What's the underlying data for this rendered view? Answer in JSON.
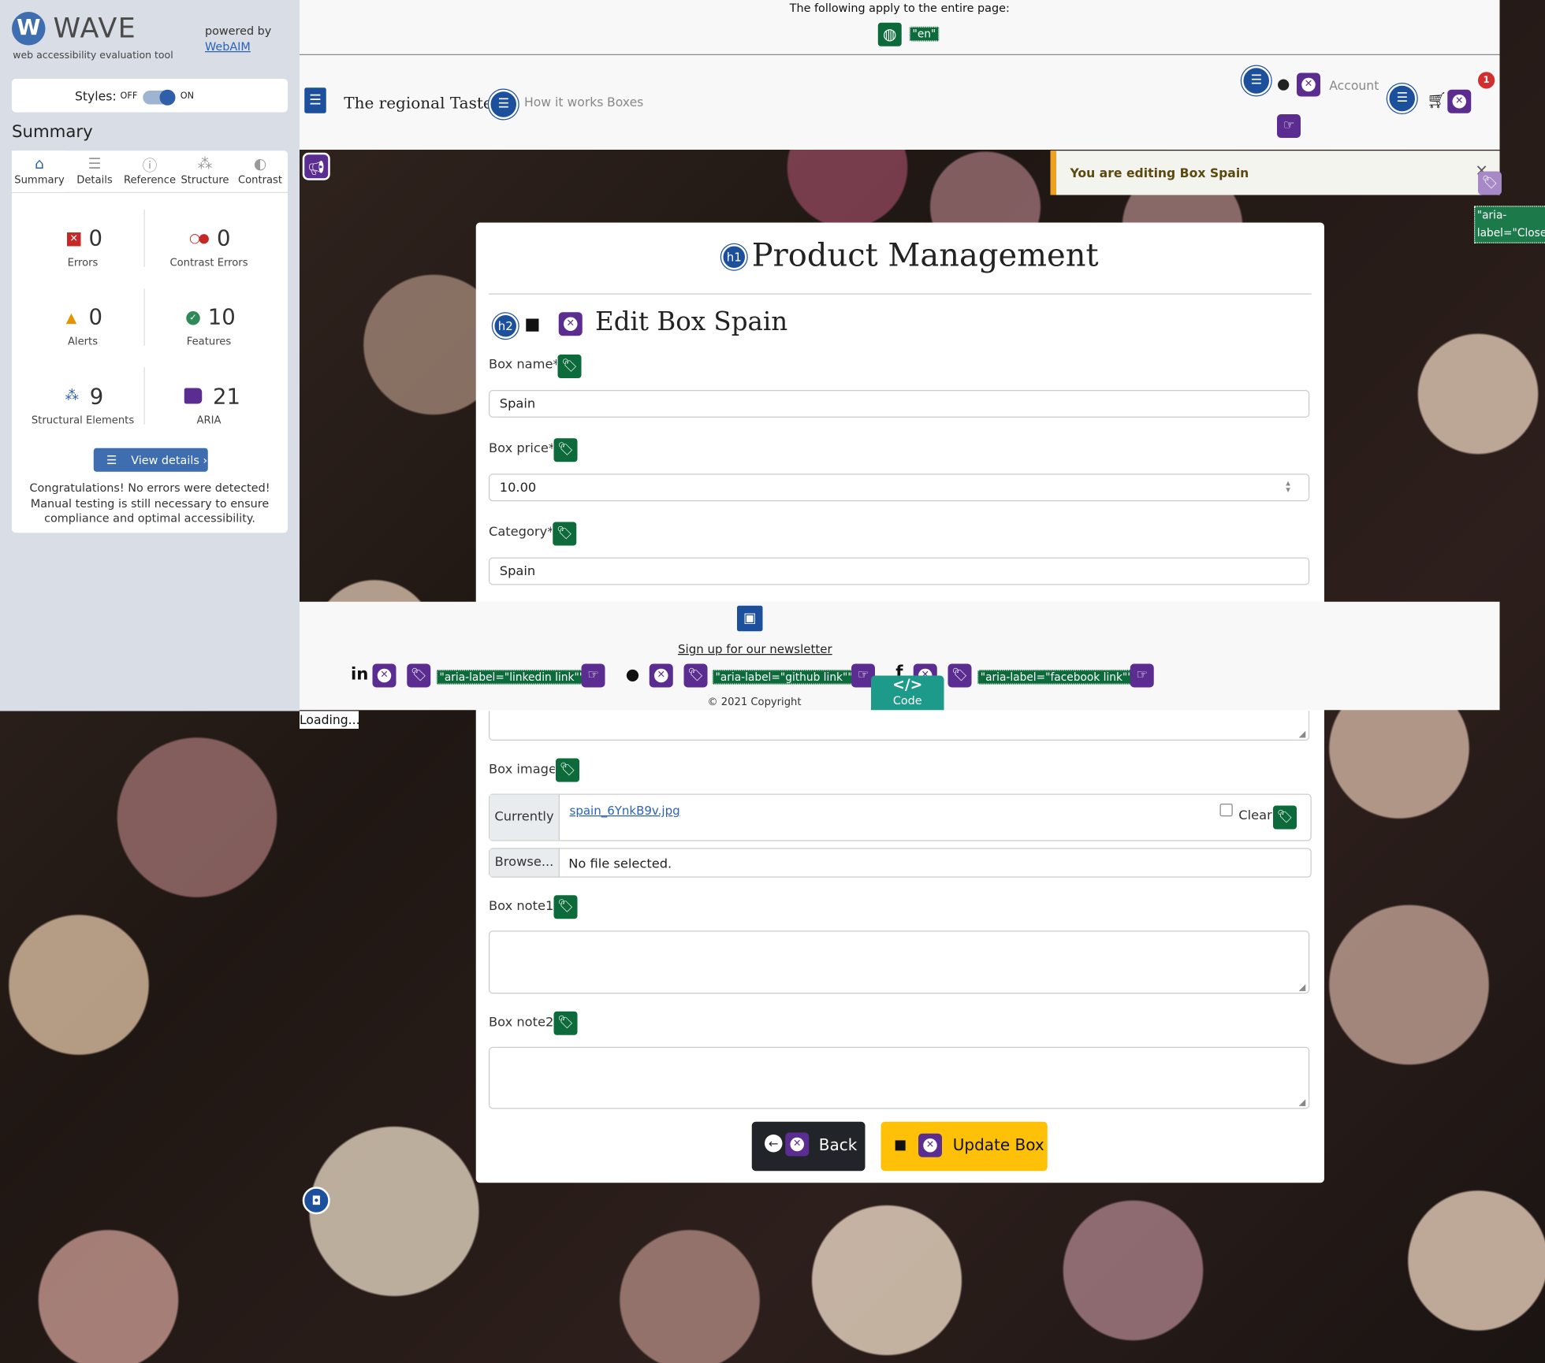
{
  "wave": {
    "logo_letter": "W",
    "title": "WAVE",
    "subtitle": "web accessibility evaluation tool",
    "powered_by": "powered by",
    "powered_link": "WebAIM",
    "styles_label": "Styles:",
    "styles_off": "OFF",
    "styles_on": "ON",
    "summary_heading": "Summary",
    "tabs": [
      {
        "label": "Summary",
        "icon": "home-icon"
      },
      {
        "label": "Details",
        "icon": "list-icon"
      },
      {
        "label": "Reference",
        "icon": "info-icon"
      },
      {
        "label": "Structure",
        "icon": "structure-icon"
      },
      {
        "label": "Contrast",
        "icon": "contrast-icon"
      }
    ],
    "stats": {
      "errors": {
        "count": "0",
        "label": "Errors"
      },
      "contrast": {
        "count": "0",
        "label": "Contrast Errors"
      },
      "alerts": {
        "count": "0",
        "label": "Alerts"
      },
      "features": {
        "count": "10",
        "label": "Features"
      },
      "structural": {
        "count": "9",
        "label": "Structural Elements"
      },
      "aria": {
        "count": "21",
        "label": "ARIA"
      }
    },
    "view_details": "View details ›",
    "congrats": "Congratulations! No errors were detected! Manual testing is still necessary to ensure compliance and optimal accessibility."
  },
  "page_note": {
    "text": "The following apply to the entire page:",
    "lang_badge": "\"en\""
  },
  "nav": {
    "brand": "The regional Taste",
    "links": [
      "How it works",
      "Boxes"
    ],
    "account": "Account",
    "cart_count": "1"
  },
  "toast": {
    "text": "You are editing Box Spain",
    "close": "×",
    "aria_label": "\"aria-label=\"Close\"\""
  },
  "main": {
    "h1_badge": "h1",
    "h1": "Product Management",
    "h2_badge": "h2",
    "h2": "Edit Box Spain",
    "fields": {
      "name_label": "Box name*",
      "name_value": "Spain",
      "price_label": "Box price*",
      "price_value": "10.00",
      "category_label": "Category*",
      "category_value": "Spain",
      "image_label": "Box image",
      "currently": "Currently",
      "current_file": "spain_6YnkB9v.jpg",
      "clear": "Clear",
      "browse": "Browse...",
      "no_file": "No file selected.",
      "note1_label": "Box note1",
      "note2_label": "Box note2"
    },
    "back_button": "Back",
    "update_button": "Update Box"
  },
  "footer": {
    "newsletter": "Sign up for our newsletter",
    "linkedin_label": "\"aria-label=\"linkedin link\"\"",
    "github_label": "\"aria-label=\"github link\"\"",
    "facebook_label": "\"aria-label=\"facebook link\"\"",
    "copyright": "© 2021 Copyright",
    "code_tab": "Code"
  },
  "loading": "Loading...",
  "colors": {
    "wave_blue": "#3e6db0",
    "aria_purple": "#5b2d90",
    "feature_green": "#0d6b3b",
    "update_yellow": "#ffc107",
    "back_dark": "#212529"
  }
}
